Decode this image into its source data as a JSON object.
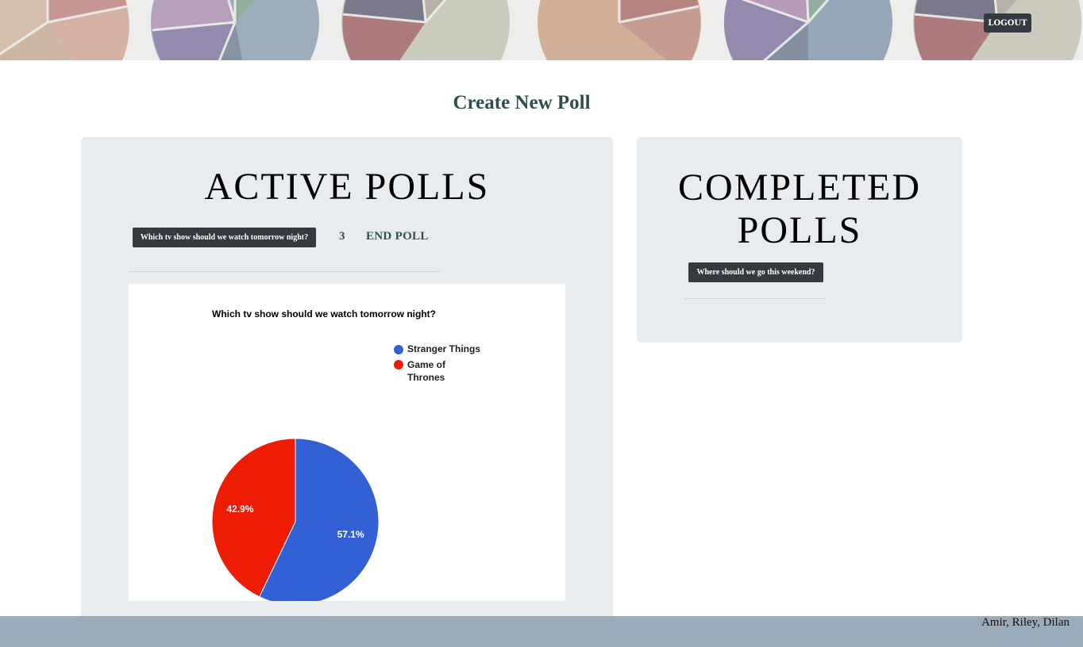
{
  "header": {
    "logout_label": "LOGOUT"
  },
  "main": {
    "create_poll_label": "Create New Poll"
  },
  "active_polls": {
    "title": "ACTIVE POLLS",
    "polls": [
      {
        "question": "Which tv show should we watch tomorrow night?",
        "vote_count": "3",
        "end_label": "END POLL"
      }
    ]
  },
  "completed_polls": {
    "title": "COMPLETED POLLS",
    "polls": [
      {
        "question": "Where should we go this weekend?"
      }
    ]
  },
  "chart_data": {
    "type": "pie",
    "title": "Which tv show should we watch tomorrow night?",
    "categories": [
      "Stranger Things",
      "Game of Thrones"
    ],
    "values": [
      57.1,
      42.9
    ],
    "labels": [
      "57.1%",
      "42.9%"
    ],
    "colors": [
      "#3460d6",
      "#ee1c03"
    ],
    "legend": "right"
  },
  "footer": {
    "credits": "Amir, Riley, Dilan"
  },
  "colors": {
    "button_bg": "#343a40",
    "panel_bg": "#e9ecef",
    "footer_bg": "#9aabb9",
    "link_color": "#2f4f4f"
  }
}
